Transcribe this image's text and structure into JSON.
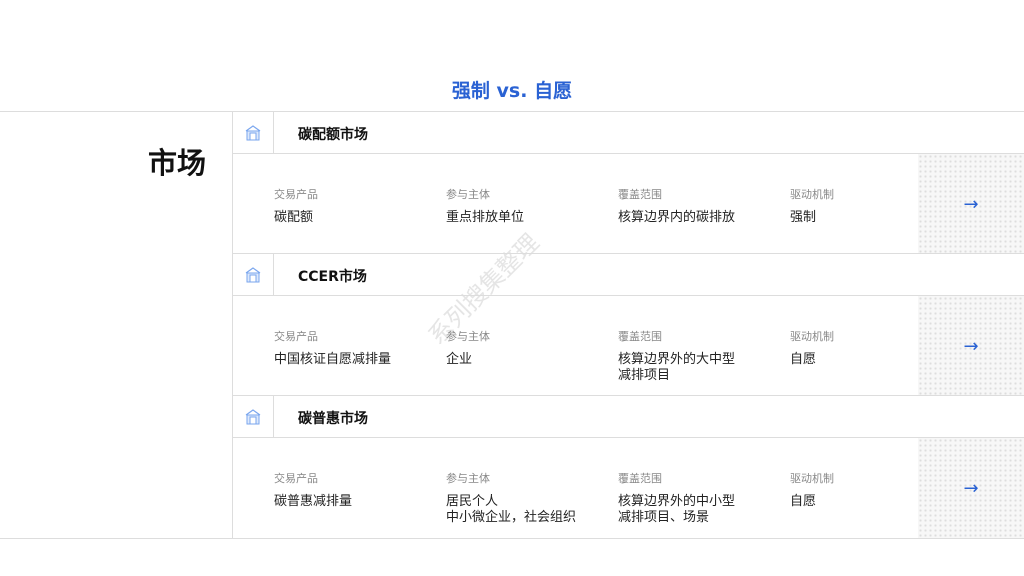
{
  "title": "强制 vs. 自愿",
  "side_label": "市场",
  "watermark": "系列搜集整理",
  "column_labels": [
    "交易产品",
    "参与主体",
    "覆盖范围",
    "驱动机制"
  ],
  "markets": [
    {
      "name": "碳配额市场",
      "values": [
        "碳配额",
        "重点排放单位",
        "核算边界内的碳排放",
        "强制"
      ]
    },
    {
      "name": "CCER市场",
      "values": [
        "中国核证自愿减排量",
        "企业",
        "核算边界外的大中型\n减排项目",
        "自愿"
      ]
    },
    {
      "name": "碳普惠市场",
      "values": [
        "碳普惠减排量",
        "居民个人\n中小微企业，社会组织",
        "核算边界外的中小型\n减排项目、场景",
        "自愿"
      ]
    }
  ],
  "arrow": "→"
}
